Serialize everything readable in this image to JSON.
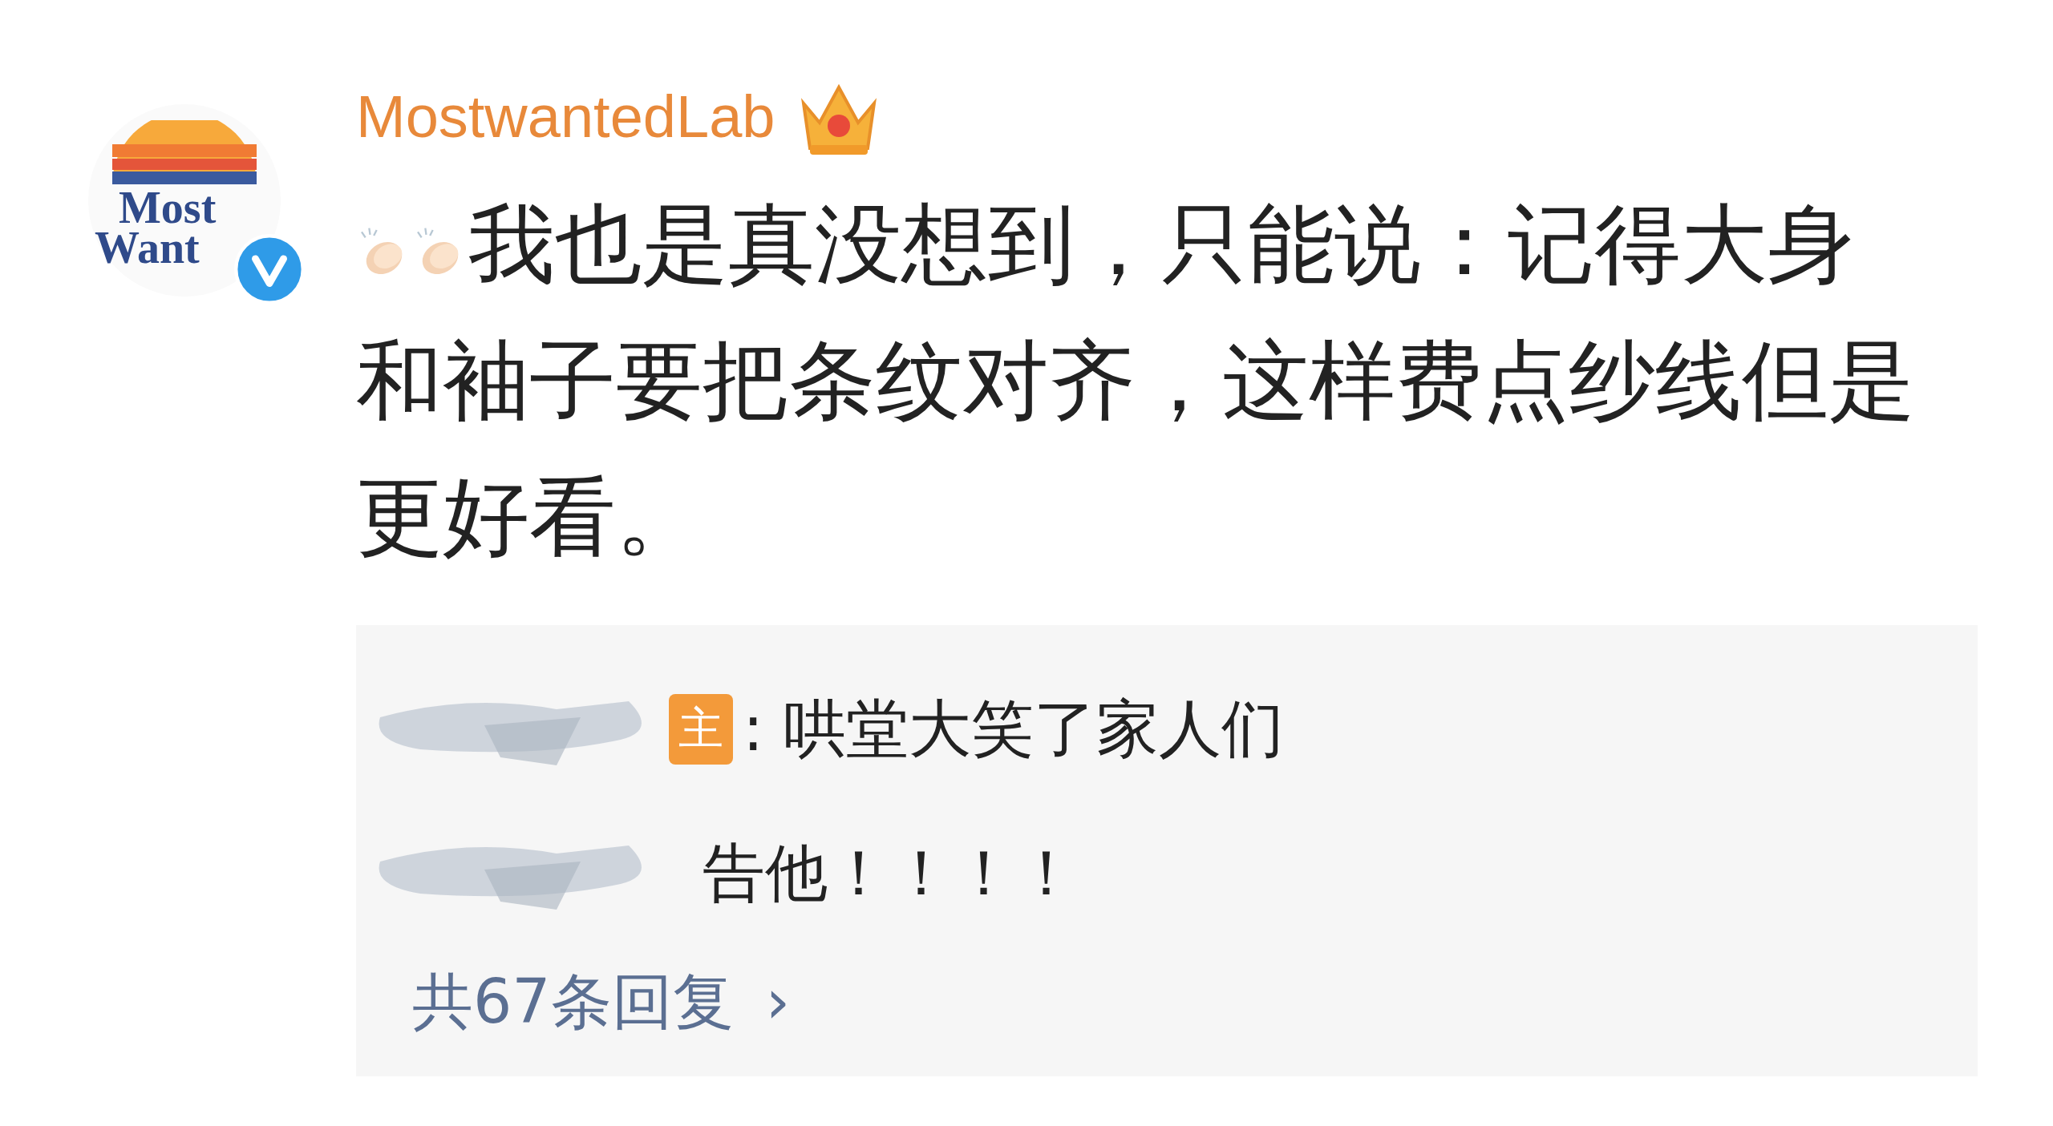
{
  "comment": {
    "avatar": {
      "line_1": "Most",
      "line_2": "Want",
      "verified": true
    },
    "username": "MostwantedLab",
    "text": "我也是真没想到，只能说：记得大身和袖子要把条纹对齐，这样费点纱线但是更好看。"
  },
  "replies": [
    {
      "badge": "主",
      "text": ": 哄堂大笑了家人们"
    },
    {
      "text": "告他！！！！"
    }
  ],
  "more_replies": {
    "label": "共67条回复",
    "arrow": "›"
  }
}
